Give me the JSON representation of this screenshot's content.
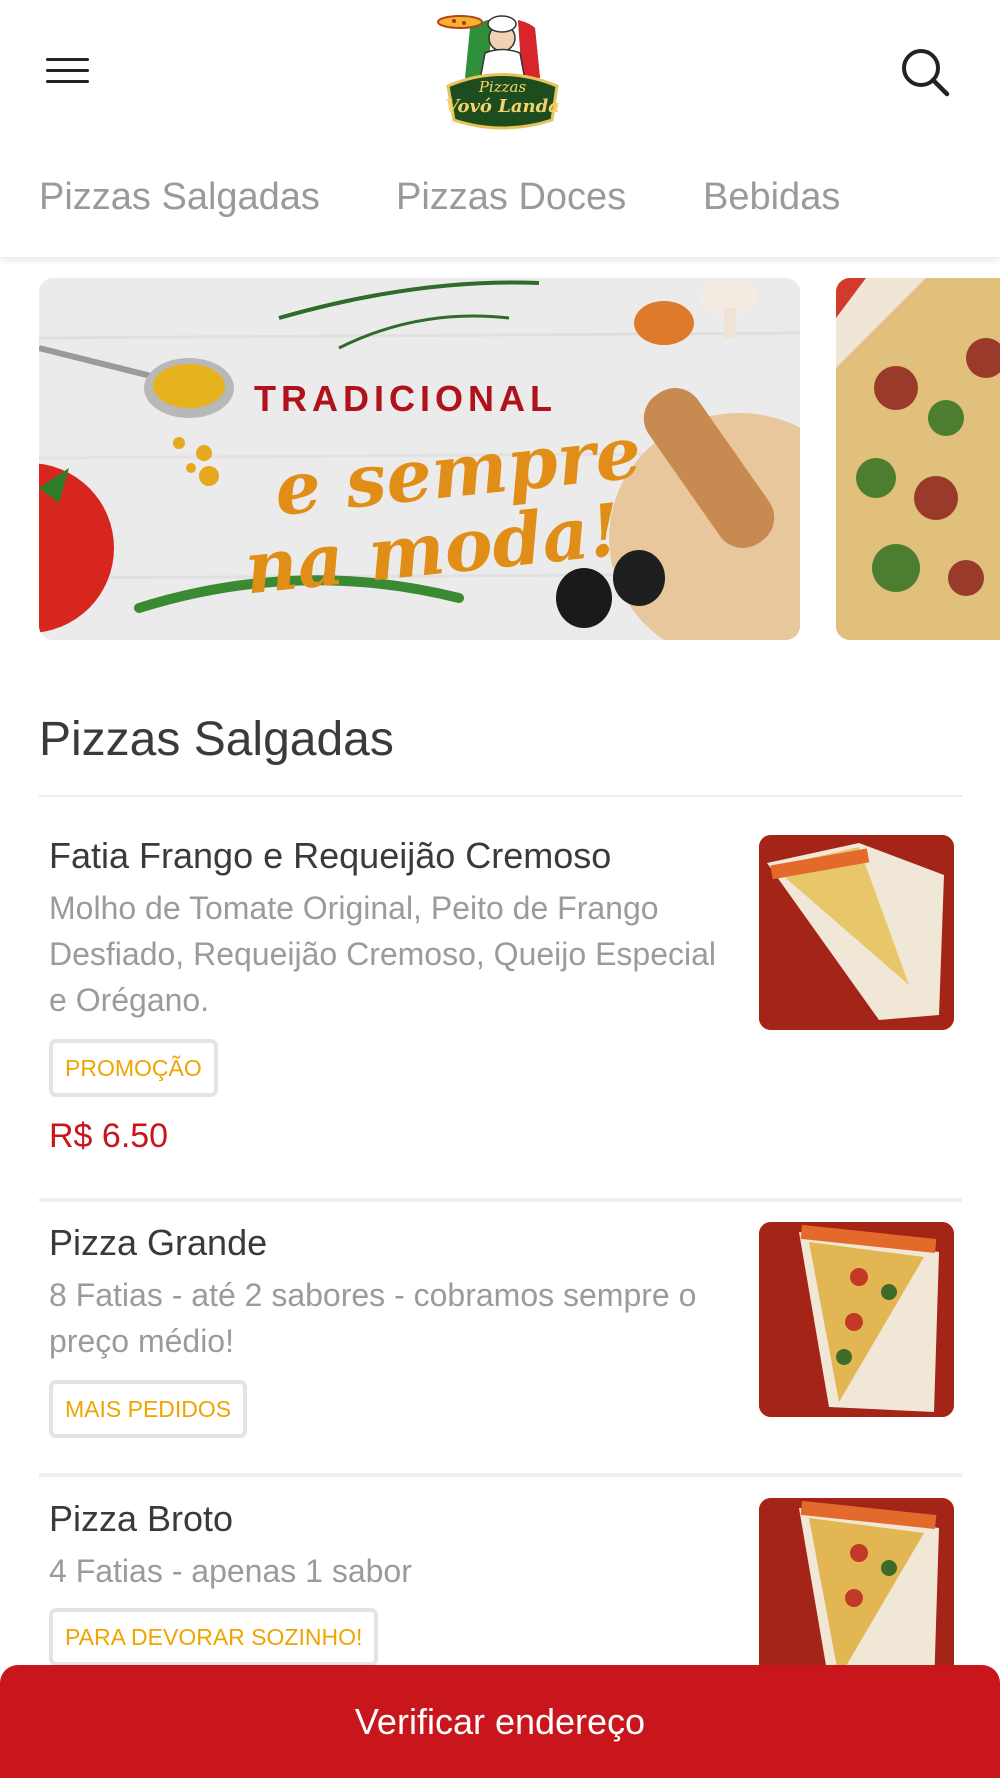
{
  "header": {
    "logo_line1": "Pizzas",
    "logo_line2": "Vovó Landa"
  },
  "tabs": [
    {
      "label": "Pizzas Salgadas"
    },
    {
      "label": "Pizzas Doces"
    },
    {
      "label": "Bebidas"
    }
  ],
  "banner": {
    "title": "TRADICIONAL",
    "line1": "e sempre",
    "line2": "na moda!"
  },
  "section": {
    "title": "Pizzas Salgadas"
  },
  "items": [
    {
      "name": "Fatia Frango e Requeijão Cremoso",
      "description": "Molho de Tomate Original, Peito de Frango Desfiado, Requeijão Cremoso, Queijo Especial e Orégano.",
      "badge": "PROMOÇÃO",
      "price": "R$ 6.50"
    },
    {
      "name": "Pizza Grande",
      "description": "8 Fatias - até 2 sabores - cobramos sempre o preço médio!",
      "badge": "MAIS PEDIDOS"
    },
    {
      "name": "Pizza Broto",
      "description": "4 Fatias - apenas 1 sabor",
      "badge": "PARA DEVORAR SOZINHO!"
    }
  ],
  "cta": {
    "label": "Verificar endereço"
  },
  "colors": {
    "brand_red": "#c8161c",
    "badge_orange": "#f0a400",
    "muted_text": "#9b9b9b"
  },
  "icons": [
    "menu-icon",
    "search-icon",
    "logo"
  ]
}
